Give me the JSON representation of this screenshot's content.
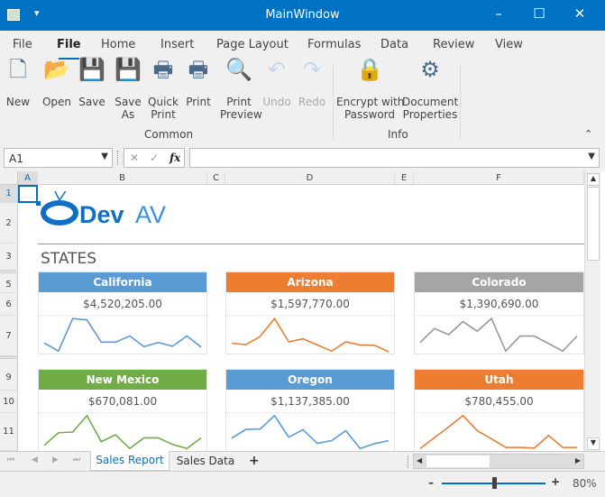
{
  "window": {
    "title": "MainWindow"
  },
  "ribbon": {
    "tabs": [
      "File",
      "File",
      "Home",
      "Insert",
      "Page Layout",
      "Formulas",
      "Data",
      "Review",
      "View"
    ],
    "active_tab": 1,
    "buttons": [
      {
        "label": "New",
        "icon": "new-document-icon"
      },
      {
        "label": "Open",
        "icon": "open-folder-icon"
      },
      {
        "label": "Save",
        "icon": "save-icon"
      },
      {
        "label": "Save\nAs",
        "icon": "save-as-icon"
      },
      {
        "label": "Quick\nPrint",
        "icon": "quick-print-icon"
      },
      {
        "label": "Print",
        "icon": "print-icon"
      },
      {
        "label": "Print\nPreview",
        "icon": "print-preview-icon"
      },
      {
        "label": "Undo",
        "icon": "undo-icon",
        "disabled": true
      },
      {
        "label": "Redo",
        "icon": "redo-icon",
        "disabled": true
      },
      {
        "label": "Encrypt with\nPassword",
        "icon": "lock-key-icon"
      },
      {
        "label": "Document\nProperties",
        "icon": "document-properties-icon"
      }
    ],
    "groups": [
      "Common",
      "Info"
    ]
  },
  "formula_bar": {
    "name_box": "A1",
    "formula": ""
  },
  "sheet": {
    "columns": [
      "A",
      "B",
      "C",
      "D",
      "E",
      "F"
    ],
    "rows": [
      "1",
      "2",
      "3",
      "5",
      "6",
      "7",
      "9",
      "10",
      "11"
    ],
    "logo": {
      "text_dev": "Dev",
      "text_av": "AV"
    },
    "section_title": "STATES",
    "cards": [
      {
        "state": "California",
        "value": "$4,520,205.00",
        "color": "#5b9bd5",
        "spark": [
          26,
          2,
          97,
          93,
          28,
          28,
          46,
          15,
          27,
          16,
          46,
          14
        ]
      },
      {
        "state": "Arizona",
        "value": "$1,597,770.00",
        "color": "#ed7d31",
        "spark": [
          25,
          21,
          45,
          97,
          29,
          38,
          20,
          2,
          29,
          20,
          19,
          0
        ]
      },
      {
        "state": "Colorado",
        "value": "$1,390,690.00",
        "color": "#a5a5a5",
        "spark": [
          27,
          68,
          50,
          88,
          60,
          97,
          2,
          46,
          46,
          24,
          2,
          46
        ]
      },
      {
        "state": "New Mexico",
        "value": "$670,081.00",
        "color": "#70ad47",
        "spark": [
          11,
          48,
          50,
          98,
          22,
          42,
          2,
          33,
          33,
          14,
          2,
          33
        ]
      },
      {
        "state": "Oregon",
        "value": "$1,137,385.00",
        "color": "#5b9bd5",
        "spark": [
          32,
          58,
          59,
          98,
          35,
          57,
          17,
          25,
          54,
          2,
          16,
          25
        ]
      },
      {
        "state": "Utah",
        "value": "$780,455.00",
        "color": "#ed7d31",
        "spark": [
          2,
          34,
          65,
          98,
          54,
          30,
          5,
          5,
          3,
          40,
          5,
          5
        ]
      }
    ]
  },
  "sheet_tabs": {
    "tabs": [
      "Sales Report",
      "Sales Data"
    ],
    "active": 0,
    "add": "+"
  },
  "status": {
    "zoom": "80%",
    "zoom_level": 0.5
  },
  "accent": "#0072c6"
}
